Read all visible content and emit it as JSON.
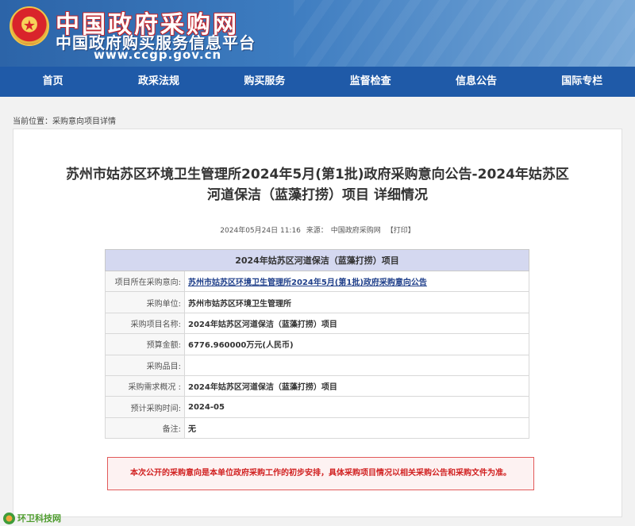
{
  "header": {
    "emblem_glyph": "★",
    "title": "中国政府采购网",
    "subtitle": "中国政府购买服务信息平台",
    "url": "www.ccgp.gov.cn"
  },
  "nav": {
    "items": [
      {
        "label": "首页"
      },
      {
        "label": "政采法规"
      },
      {
        "label": "购买服务"
      },
      {
        "label": "监督检查"
      },
      {
        "label": "信息公告"
      },
      {
        "label": "国际专栏"
      }
    ]
  },
  "breadcrumb": {
    "prefix": "当前位置：",
    "link": "采购意向项目详情"
  },
  "article": {
    "title_line1": "苏州市姑苏区环境卫生管理所2024年5月(第1批)政府采购意向公告-2024年姑苏区",
    "title_line2": "河道保洁（蓝藻打捞）项目 详细情况",
    "date": "2024年05月24日 11:16",
    "source": "来源：",
    "source_name": "中国政府采购网",
    "print_label": "【打印】"
  },
  "table": {
    "header": "2024年姑苏区河道保洁（蓝藻打捞）项目",
    "rows": [
      {
        "label": "项目所在采购意向:",
        "value": "苏州市姑苏区环境卫生管理所2024年5月(第1批)政府采购意向公告"
      },
      {
        "label": "采购单位:",
        "value": "苏州市姑苏区环境卫生管理所"
      },
      {
        "label": "采购项目名称:",
        "value": "2024年姑苏区河道保洁（蓝藻打捞）项目"
      },
      {
        "label": "预算金额:",
        "value": "6776.960000万元(人民币)"
      },
      {
        "label": "采购品目:",
        "value": ""
      },
      {
        "label": "采购需求概况 :",
        "value": "2024年姑苏区河道保洁（蓝藻打捞）项目"
      },
      {
        "label": "预计采购时间:",
        "value": "2024-05"
      },
      {
        "label": "备注:",
        "value": "无"
      }
    ]
  },
  "notice": {
    "text": "本次公开的采购意向是本单位政府采购工作的初步安排，具体采购项目情况以相关采购公告和采购文件为准。"
  },
  "watermark": {
    "text": "环卫科技网"
  }
}
